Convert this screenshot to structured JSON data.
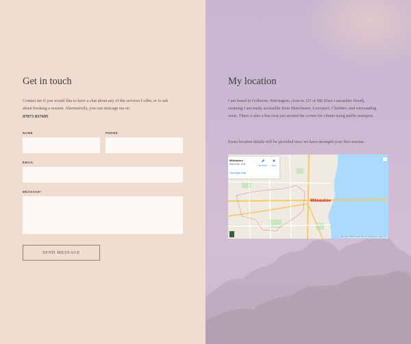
{
  "contact": {
    "title": "Get in touch",
    "intro_line1": "Contact me if you would like to have a chat about any of the services I offer, or to ask",
    "intro_line2": "about booking a session. Alternatively, you can message me on",
    "phone": "07873 837695",
    "form": {
      "name_label": "NAME",
      "phone_label": "PHONE",
      "email_label": "EMAIL",
      "message_label": "MESSAGE*",
      "name_value": "",
      "phone_value": "",
      "email_value": "",
      "message_value": "",
      "submit_label": "SEND MESSAGE"
    }
  },
  "location": {
    "title": "My location",
    "para1_line1": "I am based in Golborne, Warrington, close to J23 of M6 (East Lancashire Road),",
    "para1_line2": "meaning I am easily accessible from Manchester, Liverpool, Cheshire, and surrounding",
    "para1_line3": "areas. There is also a bus stop just around the corner for clients using public transport.",
    "para2": "Exact location details will be provided once we have arranged your first session.",
    "map": {
      "place_name": "Milwaukee",
      "place_sub": "Wisconsin, USA",
      "directions_label": "Directions",
      "save_label": "Save",
      "view_larger": "View larger map",
      "city_label": "Milwaukee",
      "attribution": "Map data ©2019 Google   Terms of Use   Report a map error",
      "directions_icon": "directions-icon",
      "save_icon": "star-icon"
    }
  },
  "colors": {
    "left_bg": "#f1ddd0",
    "right_bg": "#cdb9d3",
    "field_bg": "#fbf8f5",
    "map_water": "#a8d3f5"
  }
}
